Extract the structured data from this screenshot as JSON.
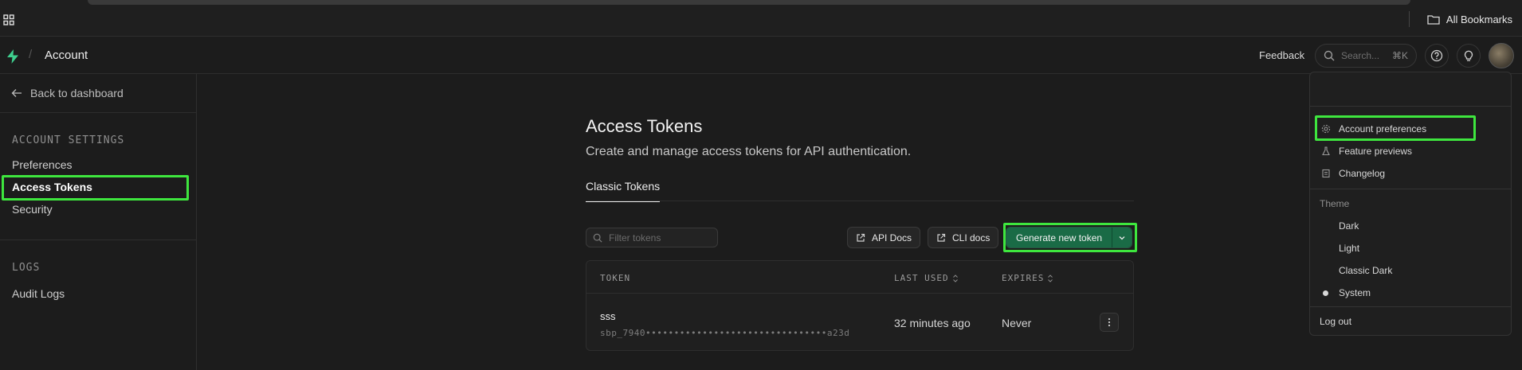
{
  "browser": {
    "bookmarks_label": "All Bookmarks"
  },
  "header": {
    "breadcrumb_title": "Account",
    "feedback_label": "Feedback",
    "search": {
      "placeholder": "Search...",
      "shortcut": "⌘K"
    }
  },
  "sidebar": {
    "back_label": "Back to dashboard",
    "sections": [
      {
        "heading": "ACCOUNT SETTINGS",
        "items": [
          "Preferences",
          "Access Tokens",
          "Security"
        ]
      },
      {
        "heading": "LOGS",
        "items": [
          "Audit Logs"
        ]
      }
    ],
    "active_item": "Access Tokens"
  },
  "main": {
    "title": "Access Tokens",
    "subtitle": "Create and manage access tokens for API authentication.",
    "tabs": [
      "Classic Tokens"
    ],
    "filter_placeholder": "Filter tokens",
    "buttons": {
      "api_docs": "API Docs",
      "cli_docs": "CLI docs",
      "generate": "Generate new token"
    },
    "table": {
      "columns": [
        "TOKEN",
        "LAST USED",
        "EXPIRES"
      ],
      "rows": [
        {
          "name": "sss",
          "token": "sbp_7940••••••••••••••••••••••••••••••••a23d",
          "last_used": "32 minutes ago",
          "expires": "Never"
        }
      ]
    }
  },
  "dropdown": {
    "items": [
      "Account preferences",
      "Feature previews",
      "Changelog"
    ],
    "theme_label": "Theme",
    "themes": [
      "Dark",
      "Light",
      "Classic Dark",
      "System"
    ],
    "selected_theme": "System",
    "logout_label": "Log out"
  },
  "colors": {
    "accent_green": "#1a6b46",
    "highlight": "#3ee63e",
    "background": "#1c1c1c"
  },
  "icons": [
    "apps-grid-icon",
    "folder-icon",
    "supabase-logo-icon",
    "search-icon",
    "help-icon",
    "lightbulb-icon",
    "arrow-left-icon",
    "external-link-icon",
    "chevron-down-icon",
    "sort-icon",
    "more-vertical-icon",
    "gear-icon",
    "flask-icon",
    "changelog-icon"
  ]
}
